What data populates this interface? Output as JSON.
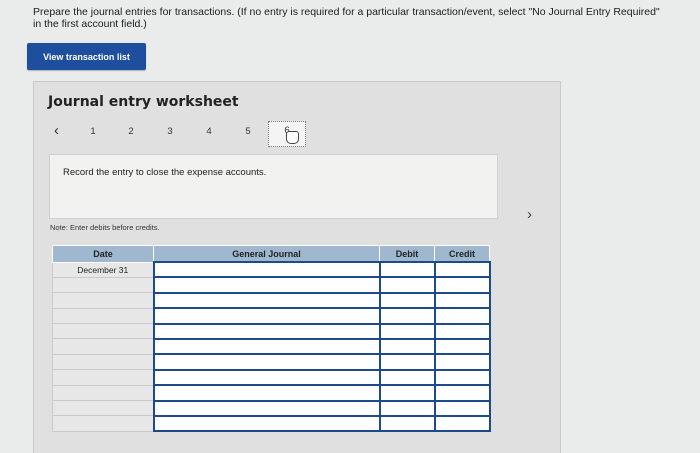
{
  "instructions": "Prepare the journal entries for transactions. (If no entry is required for a particular transaction/event, select \"No Journal Entry Required\"\nin the first account field.)",
  "view_button": "View transaction list",
  "worksheet": {
    "title": "Journal entry worksheet",
    "prev_icon": "‹",
    "next_icon": "›",
    "pages": [
      "1",
      "2",
      "3",
      "4",
      "5",
      "6"
    ],
    "active_page": "6",
    "record_text": "Record the entry to close the expense accounts.",
    "note": "Note: Enter debits before credits."
  },
  "table": {
    "headers": {
      "date": "Date",
      "journal": "General Journal",
      "debit": "Debit",
      "credit": "Credit"
    },
    "first_date": "December 31",
    "row_count": 11
  }
}
